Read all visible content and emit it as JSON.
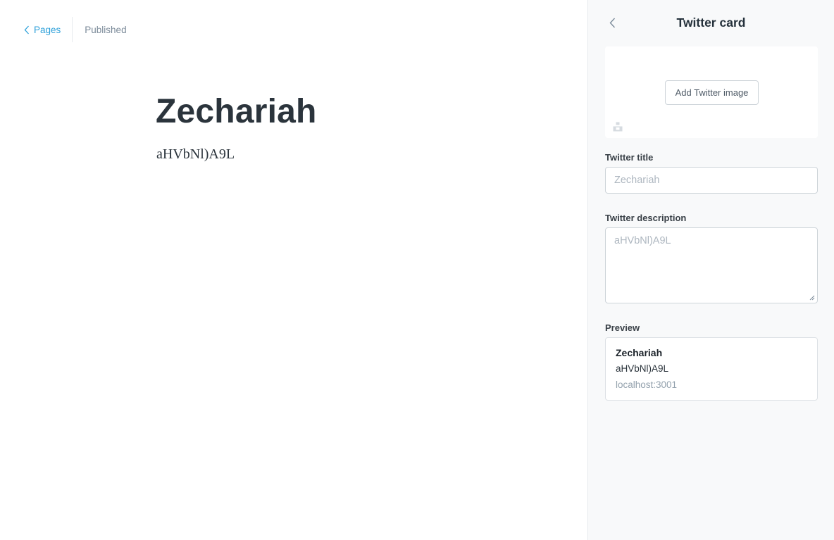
{
  "editor": {
    "back_label": "Pages",
    "status": "Published",
    "title": "Zechariah",
    "body": "aHVbNl)A9L"
  },
  "panel": {
    "title": "Twitter card",
    "add_image_label": "Add Twitter image",
    "twitter_title_label": "Twitter title",
    "twitter_title_placeholder": "Zechariah",
    "twitter_description_label": "Twitter description",
    "twitter_description_placeholder": "aHVbNl)A9L",
    "preview_label": "Preview",
    "preview": {
      "title": "Zechariah",
      "description": "aHVbNl)A9L",
      "url": "localhost:3001"
    }
  },
  "colors": {
    "link_blue": "#2fa1da",
    "panel_bg": "#f8f9fa",
    "border": "#ced4d9"
  },
  "icons": [
    "chevron-left-icon",
    "unsplash-icon",
    "resize-grip-icon"
  ]
}
